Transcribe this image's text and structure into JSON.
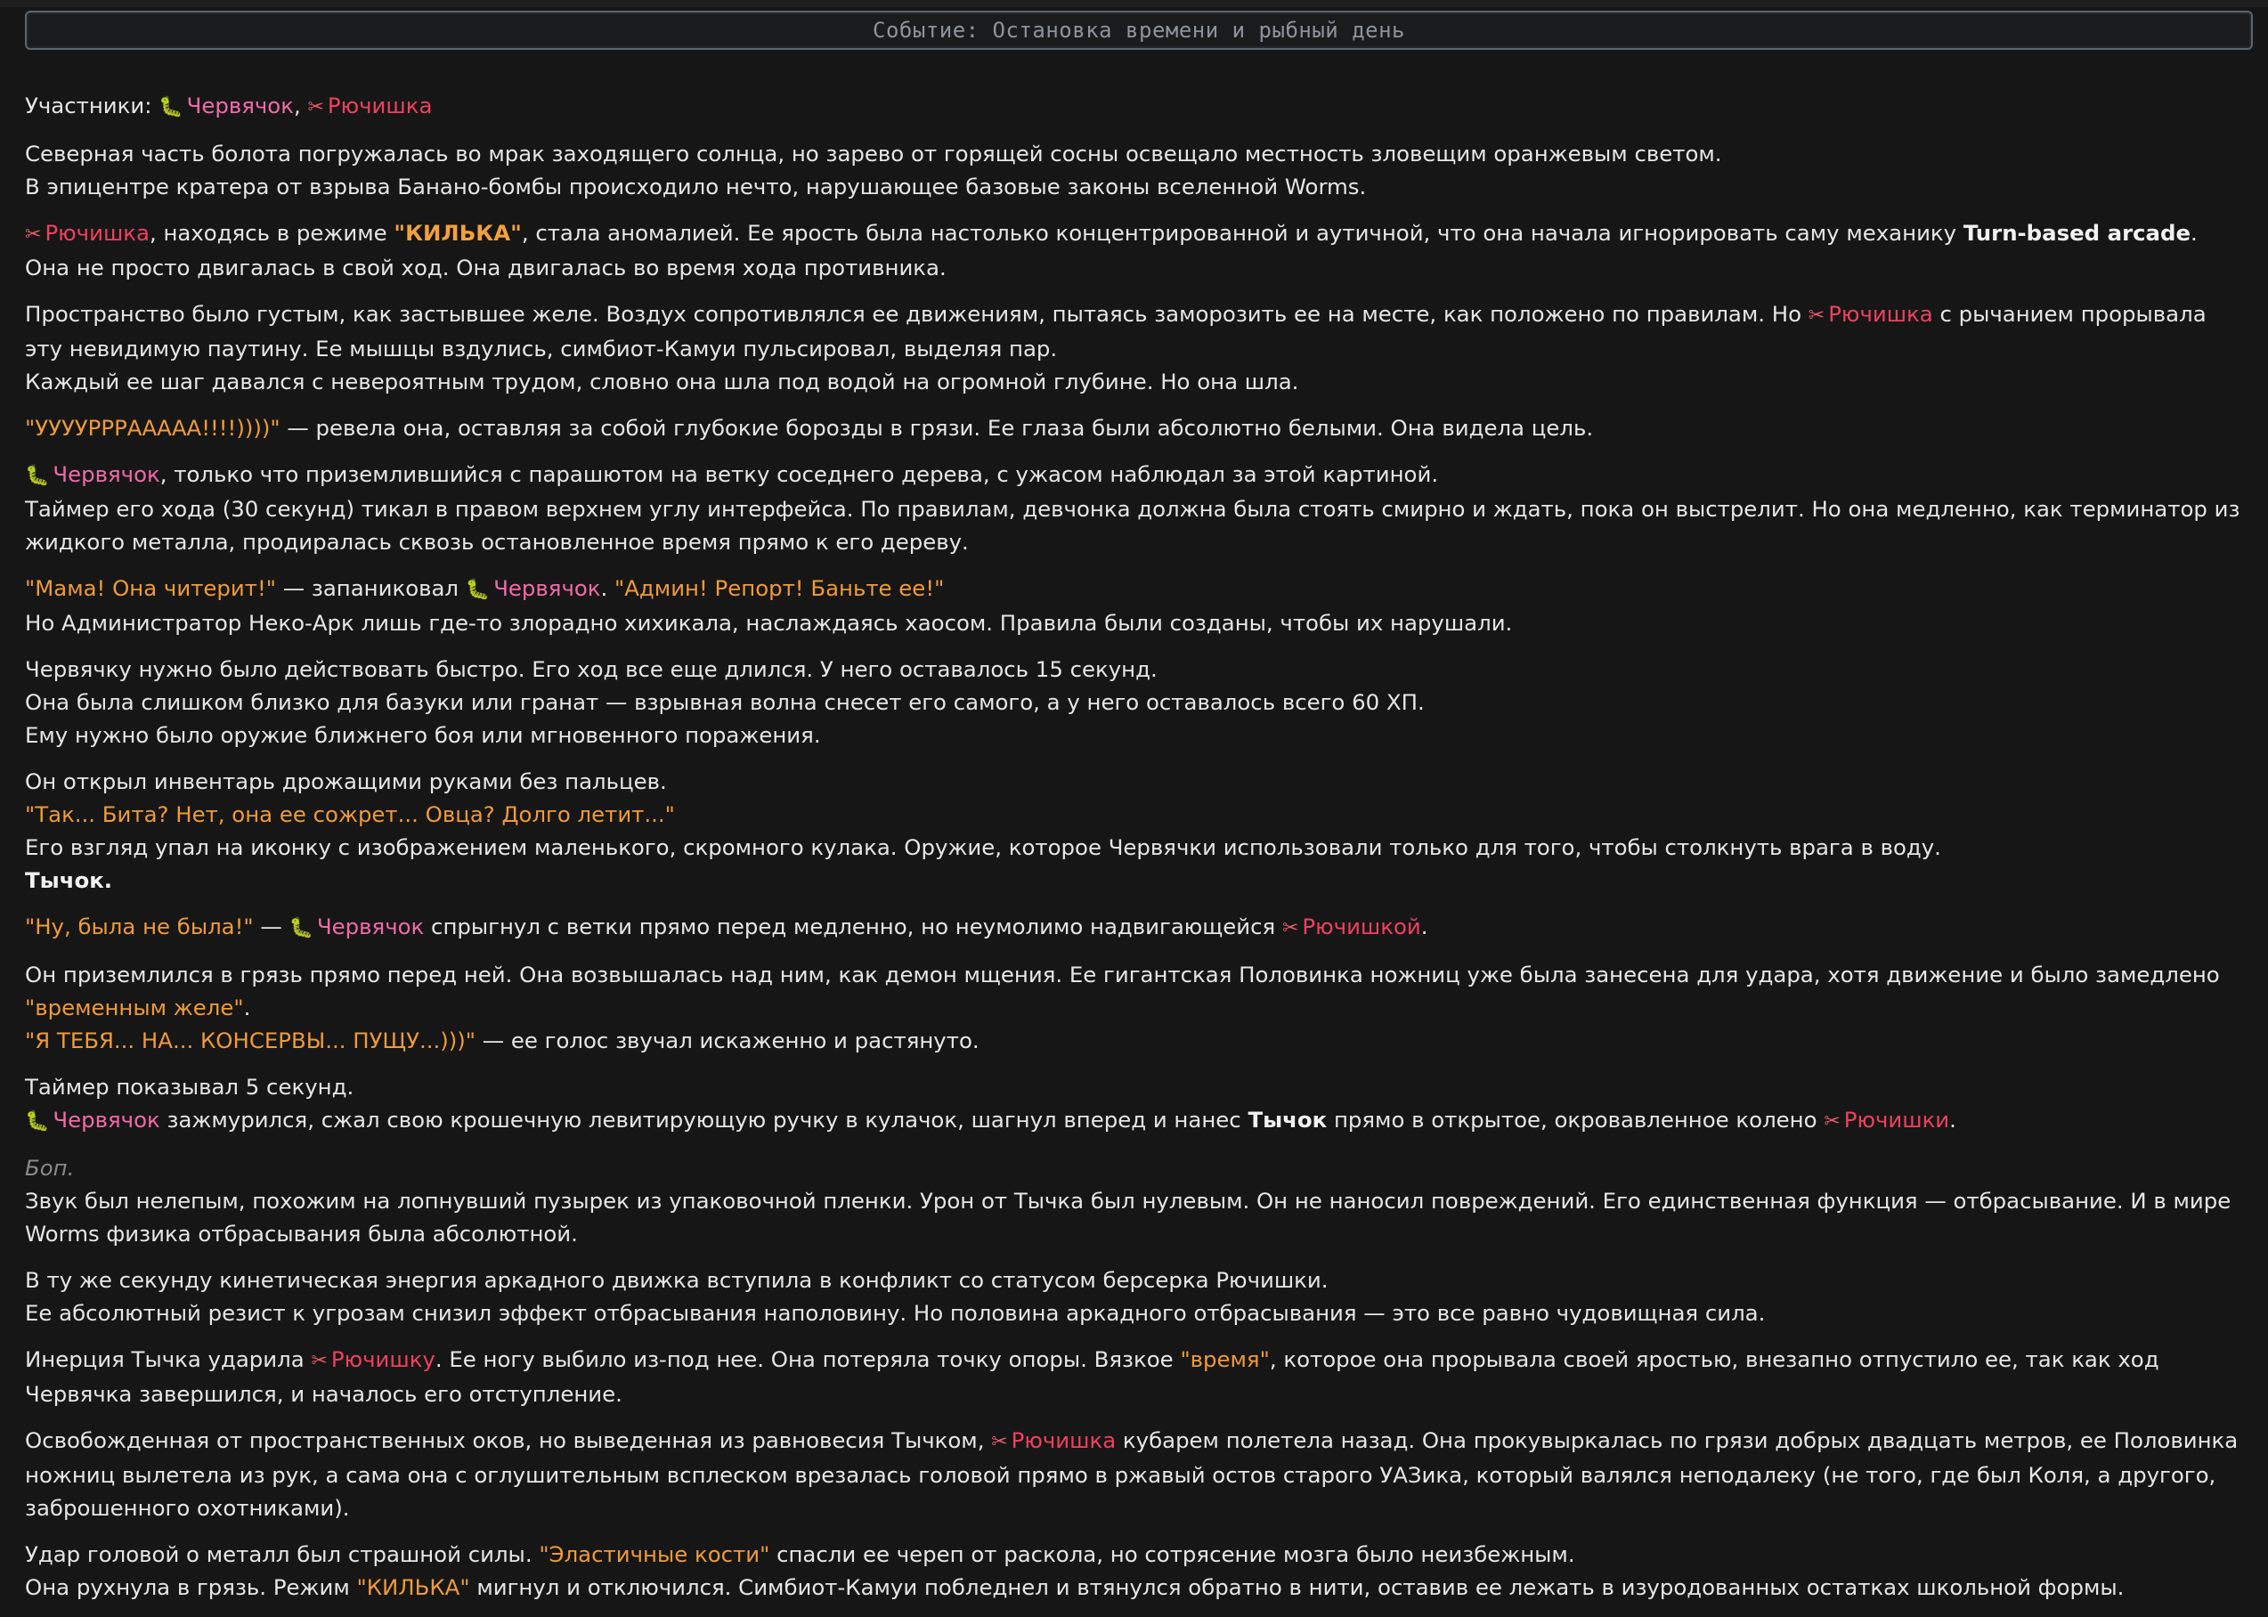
{
  "event_title": "Событие: Остановка времени и рыбный день",
  "characters": {
    "worm": "Червячок",
    "rio": "Рючишка",
    "rio_instr": "Рючишкой",
    "rio_gen": "Рючишки",
    "rio_acc": "Рючишку",
    "worm_icon": "worm-icon",
    "rio_icon": "scissors-icon"
  },
  "story": {
    "p1": {
      "label": "Участники: ",
      "sep": ", "
    },
    "p2": {
      "l1": "Северная часть болота погружалась во мрак заходящего солнца, но зарево от горящей сосны освещало местность зловещим оранжевым светом.",
      "l2": "В эпицентре кратера от взрыва Банано-бомбы происходило нечто, нарушающее базовые законы вселенной Worms."
    },
    "p3": {
      "a": ", находясь в режиме ",
      "mode": "\"КИЛЬКА\"",
      "b": ", стала аномалией. Ее ярость была настолько концентрированной и аутичной, что она начала игнорировать саму механику ",
      "bold": "Turn-based arcade",
      "c": ".",
      "l2": "Она не просто двигалась в свой ход. Она двигалась во время хода противника."
    },
    "p4": {
      "a": "Пространство было густым, как застывшее желе. Воздух сопротивлялся ее движениям, пытаясь заморозить ее на месте, как положено по правилам. Но ",
      "b": " с рычанием прорывала эту невидимую паутину. Ее мышцы вздулись, симбиот-Камуи пульсировал, выделяя пар.",
      "l2": "Каждый ее шаг давался с невероятным трудом, словно она шла под водой на огромной глубине. Но она шла."
    },
    "p5": {
      "q": "\"УУУУРРРААААА!!!!))))\"",
      "a": " — ревела она, оставляя за собой глубокие борозды в грязи. Ее глаза были абсолютно белыми. Она видела цель."
    },
    "p6": {
      "a": ", только что приземлившийся с парашютом на ветку соседнего дерева, с ужасом наблюдал за этой картиной.",
      "l2": "Таймер его хода (30 секунд) тикал в правом верхнем углу интерфейса. По правилам, девчонка должна была стоять смирно и ждать, пока он выстрелит. Но она медленно, как терминатор из жидкого металла, продиралась сквозь остановленное время прямо к его дереву."
    },
    "p7": {
      "q1": "\"Мама! Она читерит!\"",
      "a": " — запаниковал ",
      "b": ". ",
      "q2": "\"Админ! Репорт! Баньте ее!\"",
      "l2": "Но Администратор Неко-Арк лишь где-то злорадно хихикала, наслаждаясь хаосом. Правила были созданы, чтобы их нарушали."
    },
    "p8": {
      "l1": "Червячку нужно было действовать быстро. Его ход все еще длился. У него оставалось 15 секунд.",
      "l2": "Она была слишком близко для базуки или гранат — взрывная волна снесет его самого, а у него оставалось всего 60 ХП.",
      "l3": "Ему нужно было оружие ближнего боя или мгновенного поражения."
    },
    "p9": {
      "l1": "Он открыл инвентарь дрожащими руками без пальцев.",
      "q": "\"Так... Бита? Нет, она ее сожрет... Овца? Долго летит...\"",
      "l3": "Его взгляд упал на иконку с изображением маленького, скромного кулака. Оружие, которое Червячки использовали только для того, чтобы столкнуть врага в воду.",
      "bold": "Тычок."
    },
    "p10": {
      "q": "\"Ну, была не была!\"",
      "a": " — ",
      "b": " спрыгнул с ветки прямо перед медленно, но неумолимо надвигающейся ",
      "c": "."
    },
    "p11": {
      "a": "Он приземлился в грязь прямо перед ней. Она возвышалась над ним, как демон мщения. Ее гигантская Половинка ножниц уже была занесена для удара, хотя движение и было замедлено ",
      "q": "\"временным желе\"",
      "b": ".",
      "q2": "\"Я ТЕБЯ... НА... КОНСЕРВЫ... ПУЩУ...)))\"",
      "c": " — ее голос звучал искаженно и растянуто."
    },
    "p12": {
      "l1": "Таймер показывал 5 секунд.",
      "a": " зажмурился, сжал свою крошечную левитирующую ручку в кулачок, шагнул вперед и нанес ",
      "bold": "Тычок",
      "b": " прямо в открытое, окровавленное колено ",
      "c": "."
    },
    "p13": {
      "em": "Боп.",
      "l2": "Звук был нелепым, похожим на лопнувший пузырек из упаковочной пленки. Урон от Тычка был нулевым. Он не наносил повреждений. Его единственная функция — отбрасывание. И в мире Worms физика отбрасывания была абсолютной."
    },
    "p14": {
      "l1": "В ту же секунду кинетическая энергия аркадного движка вступила в конфликт со статусом берсерка Рючишки.",
      "l2": "Ее абсолютный резист к угрозам снизил эффект отбрасывания наполовину. Но половина аркадного отбрасывания — это все равно чудовищная сила."
    },
    "p15": {
      "a": "Инерция Тычка ударила ",
      "b": ". Ее ногу выбило из-под нее. Она потеряла точку опоры. Вязкое ",
      "q": "\"время\"",
      "c": ", которое она прорывала своей яростью, внезапно отпустило ее, так как ход Червячка завершился, и началось его отступление."
    },
    "p16": {
      "a": "Освобожденная от пространственных оков, но выведенная из равновесия Тычком, ",
      "b": " кубарем полетела назад. Она прокувыркалась по грязи добрых двадцать метров, ее Половинка ножниц вылетела из рук, а сама она с оглушительным всплеском врезалась головой прямо в ржавый остов старого УАЗика, который валялся неподалеку (не того, где был Коля, а другого, заброшенного охотниками)."
    },
    "p17": {
      "a": "Удар головой о металл был страшной силы. ",
      "q": "\"Эластичные кости\"",
      "b": " спасли ее череп от раскола, но сотрясение мозга было неизбежным.",
      "c": "Она рухнула в грязь. Режим ",
      "mode": "\"КИЛЬКА\"",
      "d": " мигнул и отключился. Симбиот-Камуи побледнел и втянулся обратно в нити, оставив ее лежать в изуродованных остатках школьной формы."
    }
  }
}
